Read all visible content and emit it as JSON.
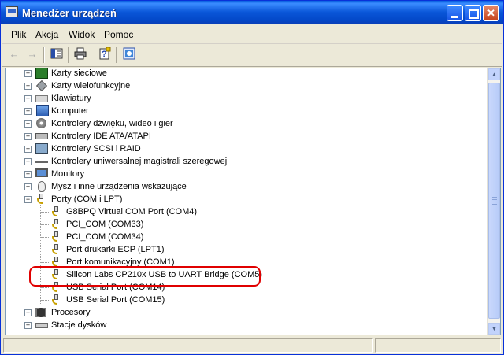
{
  "window": {
    "title": "Menedżer urządzeń"
  },
  "menu": [
    "Plik",
    "Akcja",
    "Widok",
    "Pomoc"
  ],
  "toolbar": {
    "back_icon": "arrow-left-icon",
    "forward_icon": "arrow-right-icon",
    "console_tree_icon": "console-tree-icon",
    "print_icon": "printer-icon",
    "help_icon": "help-icon",
    "properties_icon": "properties-icon"
  },
  "tree": {
    "categories_top": [
      {
        "label": "Karty sieciowe",
        "icon": "network-card-icon",
        "expander": "+"
      },
      {
        "label": "Karty wielofunkcyjne",
        "icon": "multifunction-card-icon",
        "expander": "+"
      },
      {
        "label": "Klawiatury",
        "icon": "keyboard-icon",
        "expander": "+"
      },
      {
        "label": "Komputer",
        "icon": "computer-icon",
        "expander": "+"
      },
      {
        "label": "Kontrolery dźwięku, wideo i gier",
        "icon": "sound-icon",
        "expander": "+"
      },
      {
        "label": "Kontrolery IDE ATA/ATAPI",
        "icon": "ide-controller-icon",
        "expander": "+"
      },
      {
        "label": "Kontrolery SCSI i RAID",
        "icon": "scsi-controller-icon",
        "expander": "+"
      },
      {
        "label": "Kontrolery uniwersalnej magistrali szeregowej",
        "icon": "usb-icon",
        "expander": "+"
      },
      {
        "label": "Monitory",
        "icon": "monitor-icon",
        "expander": "+"
      },
      {
        "label": "Mysz i inne urządzenia wskazujące",
        "icon": "mouse-icon",
        "expander": "+"
      }
    ],
    "ports": {
      "label": "Porty (COM i LPT)",
      "icon": "port-icon",
      "expander": "−",
      "children": [
        "G8BPQ Virtual COM Port (COM4)",
        "PCI_COM (COM33)",
        "PCI_COM (COM34)",
        "Port drukarki ECP (LPT1)",
        "Port komunikacyjny (COM1)",
        "Silicon Labs CP210x USB to UART Bridge (COM5)",
        "USB Serial Port (COM14)",
        "USB Serial Port (COM15)"
      ]
    },
    "categories_bottom": [
      {
        "label": "Procesory",
        "icon": "processor-icon",
        "expander": "+"
      },
      {
        "label": "Stacje dysków",
        "icon": "disk-drive-icon",
        "expander": "+"
      }
    ]
  },
  "highlight_color": "#e00000"
}
